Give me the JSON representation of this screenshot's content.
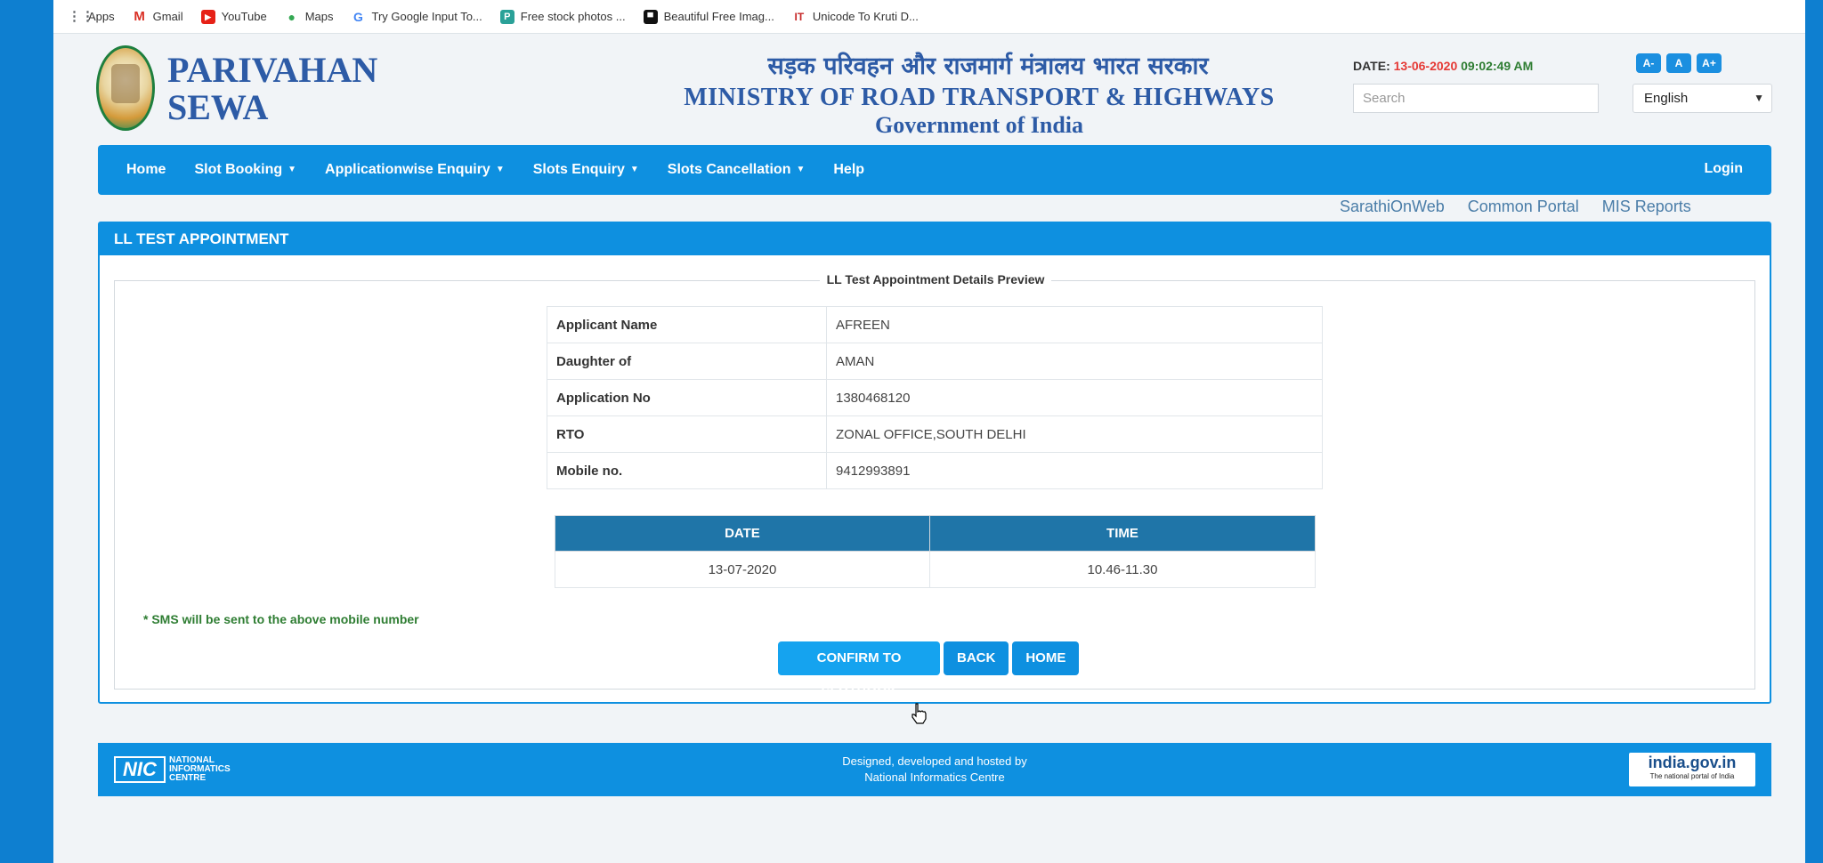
{
  "bookmarks": [
    {
      "label": "Apps",
      "icon": "apps-grid-icon",
      "color": "#d93025"
    },
    {
      "label": "Gmail",
      "icon": "gmail-icon",
      "color": "#d93025"
    },
    {
      "label": "YouTube",
      "icon": "youtube-icon",
      "color": "#e62117"
    },
    {
      "label": "Maps",
      "icon": "maps-icon",
      "color": "#34a853"
    },
    {
      "label": "Try Google Input To...",
      "icon": "google-icon",
      "color": "#4285f4"
    },
    {
      "label": "Free stock photos ...",
      "icon": "stock-photos-icon",
      "color": "#2aa198"
    },
    {
      "label": "Beautiful Free Imag...",
      "icon": "unsplash-icon",
      "color": "#111111"
    },
    {
      "label": "Unicode To Kruti D...",
      "icon": "it-icon",
      "color": "#c62828"
    }
  ],
  "header": {
    "logo_line1": "PARIVAHAN",
    "logo_line2": "SEWA",
    "hindi_title": "सड़क परिवहन और राजमार्ग मंत्रालय भारत सरकार",
    "ministry_title": "MINISTRY OF ROAD TRANSPORT & HIGHWAYS",
    "govt_title": "Government of India",
    "date_label": "DATE:",
    "date_value": "13-06-2020",
    "time_value": "09:02:49 AM",
    "font_buttons": [
      "A-",
      "A",
      "A+"
    ],
    "search_placeholder": "Search",
    "language": "English"
  },
  "nav": {
    "items": [
      {
        "label": "Home",
        "dropdown": false
      },
      {
        "label": "Slot Booking",
        "dropdown": true
      },
      {
        "label": "Applicationwise Enquiry",
        "dropdown": true
      },
      {
        "label": "Slots Enquiry",
        "dropdown": true
      },
      {
        "label": "Slots Cancellation",
        "dropdown": true
      },
      {
        "label": "Help",
        "dropdown": false
      }
    ],
    "login": "Login"
  },
  "quick_links": [
    "SarathiOnWeb",
    "Common Portal",
    "MIS Reports"
  ],
  "panel": {
    "title": "LL TEST APPOINTMENT",
    "legend": "LL Test Appointment Details Preview",
    "details": [
      {
        "key": "Applicant Name",
        "value": "AFREEN"
      },
      {
        "key": "Daughter of",
        "value": "AMAN"
      },
      {
        "key": "Application No",
        "value": "1380468120"
      },
      {
        "key": "RTO",
        "value": "ZONAL OFFICE,SOUTH DELHI"
      },
      {
        "key": "Mobile no.",
        "value": "9412993891"
      }
    ],
    "slot_headers": [
      "DATE",
      "TIME"
    ],
    "slot_values": [
      "13-07-2020",
      "10.46-11.30"
    ],
    "sms_note": "* SMS will be sent to the above mobile number",
    "buttons": {
      "confirm": "CONFIRM TO SLOTBOOK",
      "back": "BACK",
      "home": "HOME"
    }
  },
  "footer": {
    "nic_abbr": "NIC",
    "nic_name_1": "NATIONAL",
    "nic_name_2": "INFORMATICS",
    "nic_name_3": "CENTRE",
    "credit_line1": "Designed, developed and hosted by",
    "credit_line2": "National Informatics Centre",
    "india_gov_title": "india.gov.in",
    "india_gov_tagline": "The national portal of India"
  },
  "colors": {
    "primary_blue": "#0e90e0",
    "table_header": "#1f75a8",
    "date_red": "#e53935",
    "time_green": "#2e7d32"
  }
}
